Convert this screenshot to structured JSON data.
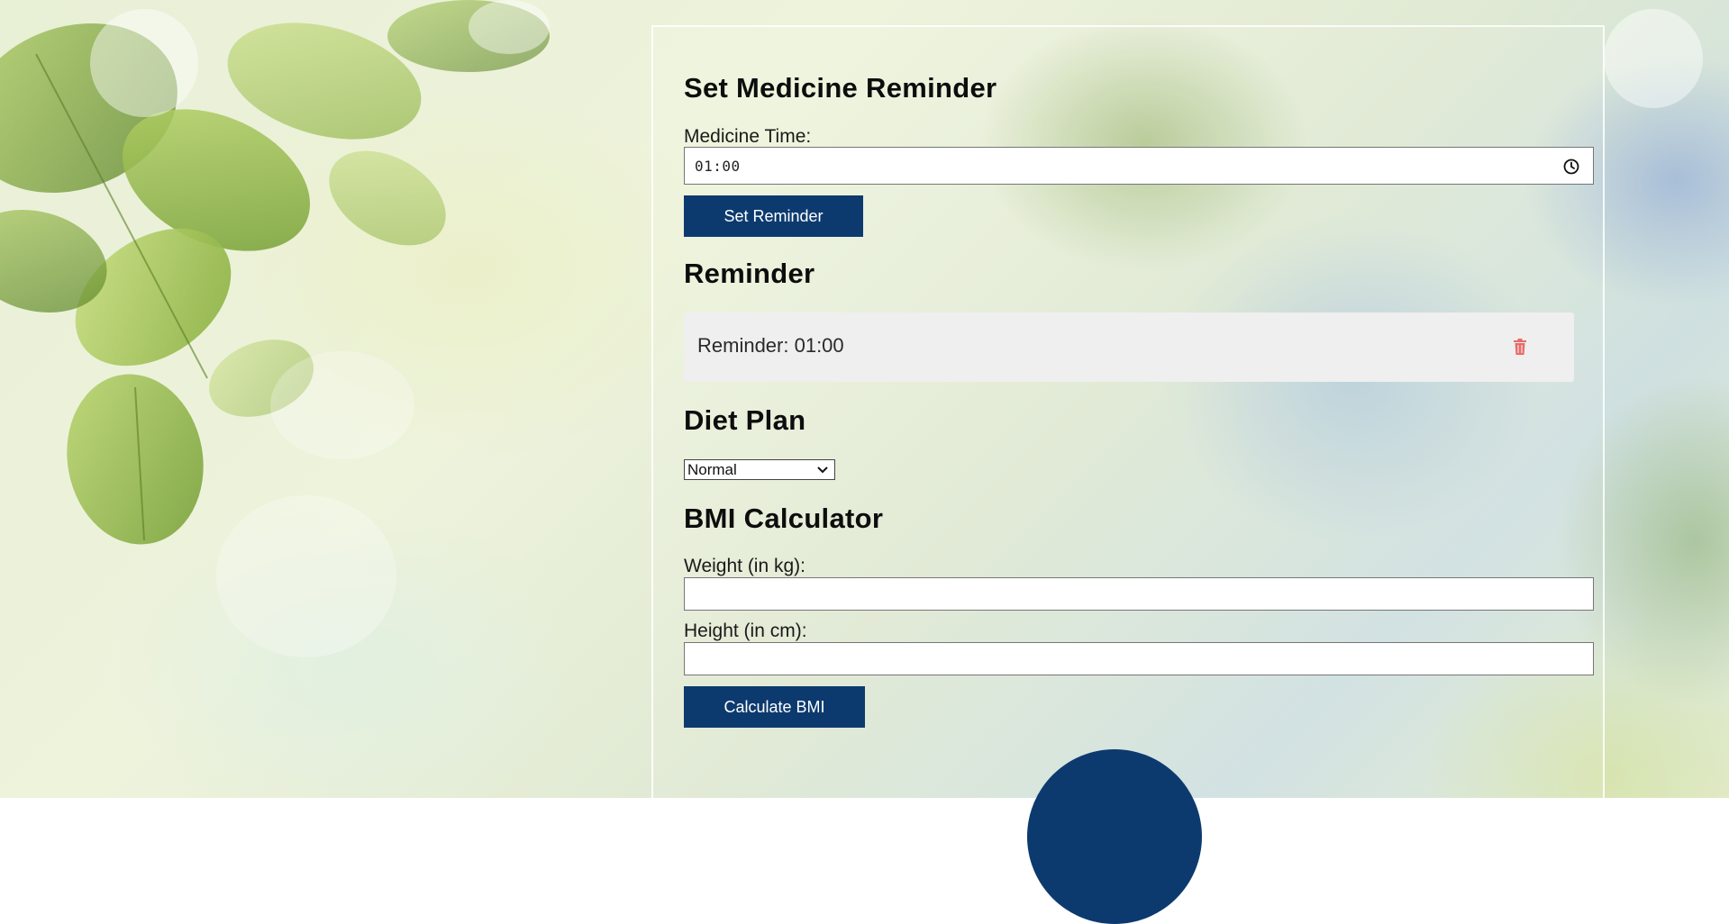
{
  "reminder_section": {
    "title": "Set Medicine Reminder",
    "time_label": "Medicine Time:",
    "time_value": "01:00",
    "set_button": "Set Reminder"
  },
  "reminder_list": {
    "title": "Reminder",
    "items": [
      {
        "text": "Reminder: 01:00",
        "delete_icon": "trash-icon"
      }
    ]
  },
  "diet_plan": {
    "title": "Diet Plan",
    "selected": "Normal"
  },
  "bmi": {
    "title": "BMI Calculator",
    "weight_label": "Weight (in kg):",
    "weight_value": "",
    "height_label": "Height (in cm):",
    "height_value": "",
    "calculate_button": "Calculate BMI"
  },
  "colors": {
    "button_bg": "#0d3a6e",
    "delete_icon": "#e86a6a",
    "reminder_bg": "#efefef"
  }
}
